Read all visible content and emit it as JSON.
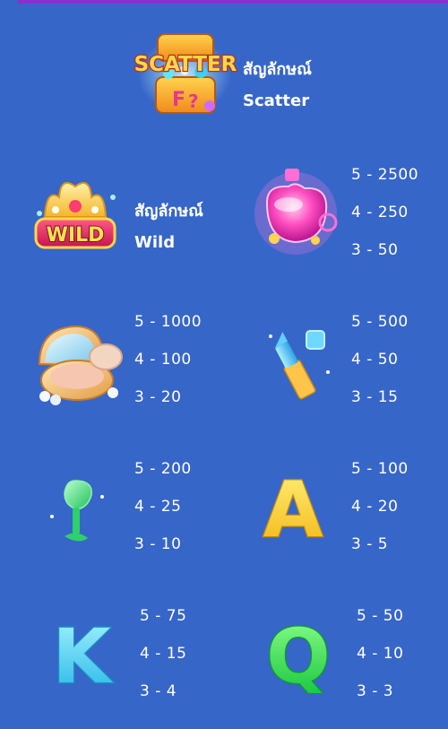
{
  "scatter": {
    "icon": "scatter-treasure-chest-icon",
    "logo_text": "SCATTER",
    "label_line1": "สัญลักษณ์",
    "label_line2": "Scatter"
  },
  "wild": {
    "icon": "wild-crown-icon",
    "logo_text": "WILD",
    "label_line1": "สัญลักษณ์",
    "label_line2": "Wild"
  },
  "paytable": [
    {
      "icon": "perfume-bottle-icon",
      "pays": [
        "5 - 2500",
        "4 - 250",
        "3 - 50"
      ]
    },
    {
      "icon": "powder-compact-icon",
      "pays": [
        "5 - 1000",
        "4 - 100",
        "3 - 20"
      ]
    },
    {
      "icon": "lipstick-icon",
      "pays": [
        "5 - 500",
        "4 - 50",
        "3 - 15"
      ]
    },
    {
      "icon": "makeup-brush-icon",
      "pays": [
        "5 - 200",
        "4 - 25",
        "3 - 10"
      ]
    },
    {
      "icon": "letter-a-icon",
      "glyph": "A",
      "pays": [
        "5 - 100",
        "4 - 20",
        "3 - 5"
      ]
    },
    {
      "icon": "letter-k-icon",
      "glyph": "K",
      "pays": [
        "5 - 75",
        "4 - 15",
        "3 - 4"
      ]
    },
    {
      "icon": "letter-q-icon",
      "glyph": "Q",
      "pays": [
        "5 - 50",
        "4 - 10",
        "3 - 3"
      ]
    }
  ],
  "colors": {
    "background": "#3766c9",
    "top_bar": "#8a2fd1",
    "text": "#ffffff"
  }
}
